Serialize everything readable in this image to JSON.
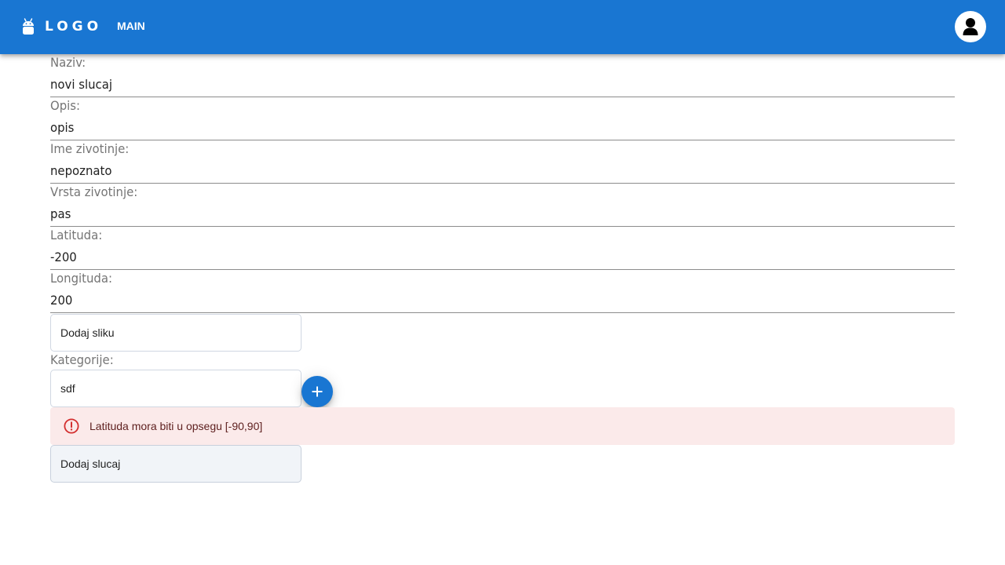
{
  "header": {
    "brand": "LOGO",
    "brand_icon": "android-icon",
    "nav_main": "MAIN",
    "avatar_icon": "user-icon",
    "background_color": "#1976d2"
  },
  "form": {
    "fields": [
      {
        "label": "Naziv:",
        "value": "novi slucaj"
      },
      {
        "label": "Opis:",
        "value": "opis"
      },
      {
        "label": "Ime zivotinje:",
        "value": "nepoznato"
      },
      {
        "label": "Vrsta zivotinje:",
        "value": "pas"
      },
      {
        "label": "Latituda:",
        "value": "-200"
      },
      {
        "label": "Longituda:",
        "value": "200"
      }
    ],
    "add_image_label": "Dodaj sliku",
    "categories_label": "Kategorije:",
    "category_value": "sdf",
    "add_category_icon": "plus-icon",
    "submit_label": "Dodaj slucaj"
  },
  "alert": {
    "severity": "error",
    "icon": "error-outline-icon",
    "message": "Latituda mora biti u opsegu [-90,90]",
    "background_color": "#fbeaea",
    "icon_color": "#d32f2f"
  }
}
